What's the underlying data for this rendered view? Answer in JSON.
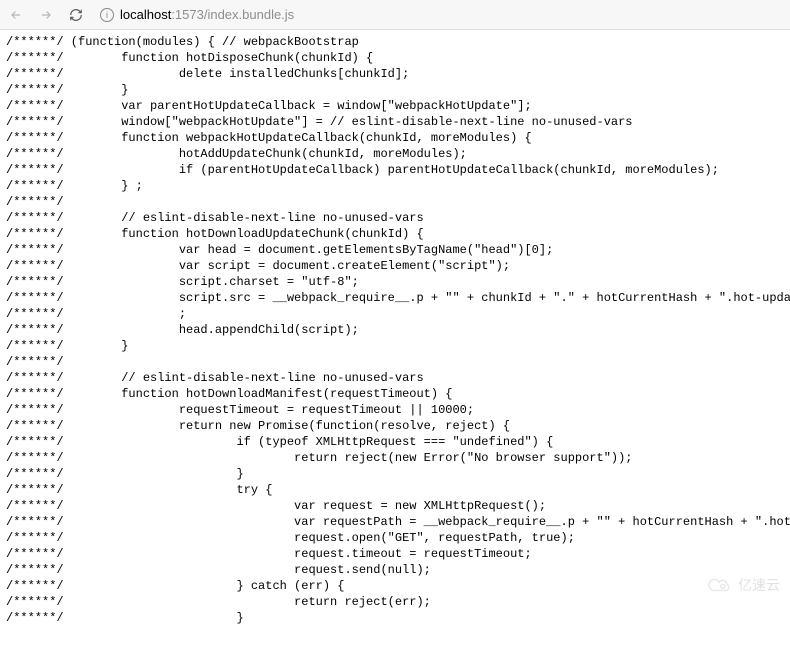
{
  "toolbar": {
    "back_icon": "back",
    "forward_icon": "forward",
    "reload_icon": "reload",
    "info_icon": "info",
    "url_host": "localhost",
    "url_path": ":1573/index.bundle.js"
  },
  "code_lines": [
    "/******/ (function(modules) { // webpackBootstrap",
    "/******/        function hotDisposeChunk(chunkId) {",
    "/******/                delete installedChunks[chunkId];",
    "/******/        }",
    "/******/        var parentHotUpdateCallback = window[\"webpackHotUpdate\"];",
    "/******/        window[\"webpackHotUpdate\"] = // eslint-disable-next-line no-unused-vars",
    "/******/        function webpackHotUpdateCallback(chunkId, moreModules) {",
    "/******/                hotAddUpdateChunk(chunkId, moreModules);",
    "/******/                if (parentHotUpdateCallback) parentHotUpdateCallback(chunkId, moreModules);",
    "/******/        } ;",
    "/******/",
    "/******/        // eslint-disable-next-line no-unused-vars",
    "/******/        function hotDownloadUpdateChunk(chunkId) {",
    "/******/                var head = document.getElementsByTagName(\"head\")[0];",
    "/******/                var script = document.createElement(\"script\");",
    "/******/                script.charset = \"utf-8\";",
    "/******/                script.src = __webpack_require__.p + \"\" + chunkId + \".\" + hotCurrentHash + \".hot-update.js\";",
    "/******/                ;",
    "/******/                head.appendChild(script);",
    "/******/        }",
    "/******/",
    "/******/        // eslint-disable-next-line no-unused-vars",
    "/******/        function hotDownloadManifest(requestTimeout) {",
    "/******/                requestTimeout = requestTimeout || 10000;",
    "/******/                return new Promise(function(resolve, reject) {",
    "/******/                        if (typeof XMLHttpRequest === \"undefined\") {",
    "/******/                                return reject(new Error(\"No browser support\"));",
    "/******/                        }",
    "/******/                        try {",
    "/******/                                var request = new XMLHttpRequest();",
    "/******/                                var requestPath = __webpack_require__.p + \"\" + hotCurrentHash + \".hot-update.json\"",
    "/******/                                request.open(\"GET\", requestPath, true);",
    "/******/                                request.timeout = requestTimeout;",
    "/******/                                request.send(null);",
    "/******/                        } catch (err) {",
    "/******/                                return reject(err);",
    "/******/                        }"
  ],
  "watermark": {
    "text": "亿速云"
  }
}
